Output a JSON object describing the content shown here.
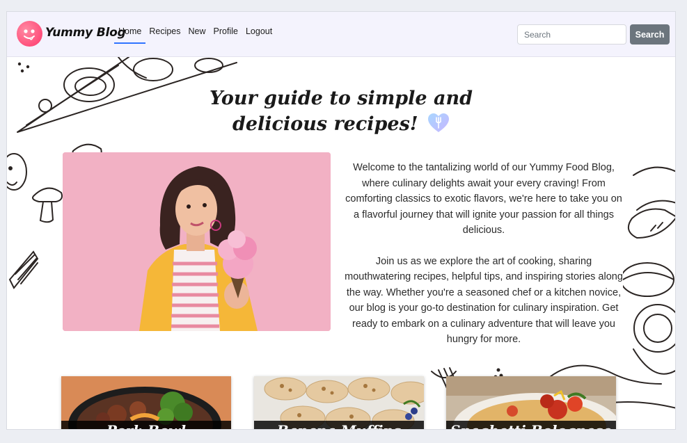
{
  "brand": {
    "name": "Yummy Blog"
  },
  "nav": {
    "links": [
      {
        "label": "Home",
        "active": true
      },
      {
        "label": "Recipes",
        "active": false
      },
      {
        "label": "New",
        "active": false
      },
      {
        "label": "Profile",
        "active": false
      },
      {
        "label": "Logout",
        "active": false
      }
    ]
  },
  "search": {
    "placeholder": "Search",
    "button_label": "Search"
  },
  "hero": {
    "headline_line1": "Your guide to simple and",
    "headline_line2": "delicious recipes!",
    "intro_paragraph1": "Welcome to the tantalizing world of our Yummy Food Blog, where culinary delights await your every craving! From comforting classics to exotic flavors, we're here to take you on a flavorful journey that will ignite your passion for all things delicious.",
    "intro_paragraph2": "Join us as we explore the art of cooking, sharing mouthwatering recipes, helpful tips, and inspiring stories along the way. Whether you're a seasoned chef or a kitchen novice, our blog is your go-to destination for culinary inspiration. Get ready to embark on a culinary adventure that will leave you hungry for more."
  },
  "cards": [
    {
      "title": "Pork Bowl"
    },
    {
      "title": "Banana Muffins"
    },
    {
      "title": "Spaghetti Bolognese"
    }
  ],
  "colors": {
    "navbar_bg": "#f4f3fd",
    "active_underline": "#2f74ff",
    "search_button": "#6c757d",
    "logo": "#ff4f7b",
    "photo_bg": "#f2b1c4"
  },
  "icons": {
    "logo": "smiling-face-icon",
    "heart": "heart-fork-icon"
  }
}
